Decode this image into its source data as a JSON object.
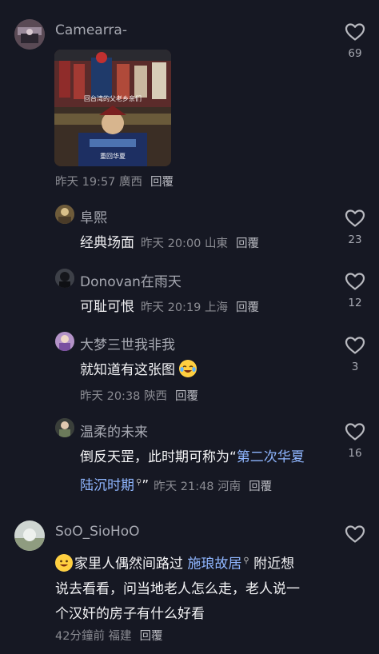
{
  "comments": [
    {
      "user": "Camearra-",
      "meta": "昨天 19:57 廣西",
      "reply": "回覆",
      "likes": "69",
      "image_caption_top": "回台湾的父老乡亲们",
      "image_caption_bottom": "重回华夏"
    },
    {
      "user": "阜熙",
      "text": "经典场面",
      "meta": "昨天 20:00 山東",
      "reply": "回覆",
      "likes": "23"
    },
    {
      "user": "Donovan在雨天",
      "text": "可耻可恨",
      "meta": "昨天 20:19 上海",
      "reply": "回覆",
      "likes": "12"
    },
    {
      "user": "大梦三世我非我",
      "text": "就知道有这张图",
      "meta": "昨天 20:38 陝西",
      "reply": "回覆",
      "likes": "3"
    },
    {
      "user": "温柔的未来",
      "text_line1_a": "倒反天罡，此时期可称为“",
      "text_tag_a": "第二次华夏",
      "text_tag_b": "陆沉时期",
      "text_line2_end": "”",
      "meta": "昨天 21:48 河南",
      "reply": "回覆",
      "likes": "16"
    },
    {
      "user": "SoO_SioHoO",
      "text_a": "家里人偶然间路过",
      "text_tag": "施琅故居",
      "text_b": "附近想",
      "text_line2": "说去看看，问当地老人怎么走，老人说一",
      "text_line3": "个汉奸的房子有什么好看",
      "meta": "42分鐘前 福建",
      "reply": "回覆",
      "likes": ""
    }
  ],
  "colors": {
    "background": "#161823",
    "tag": "#8fb6ff",
    "meta": "#8a8b92"
  }
}
